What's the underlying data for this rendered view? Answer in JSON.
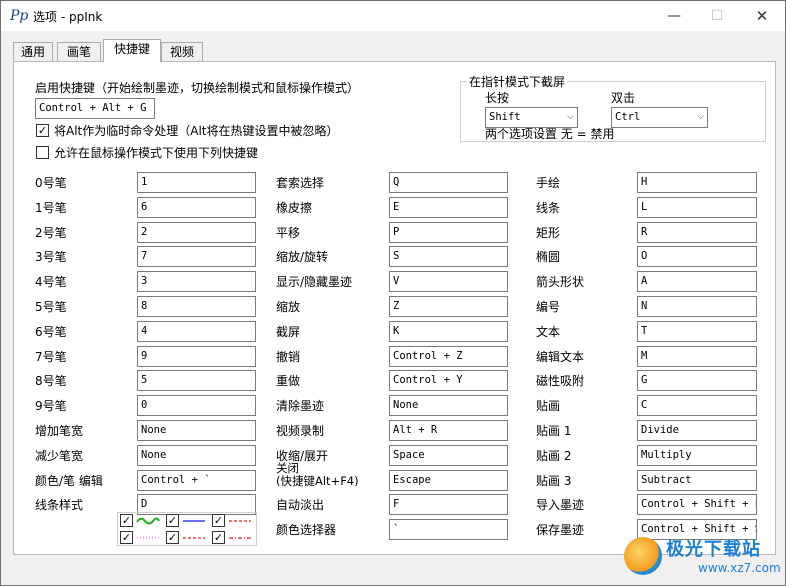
{
  "window": {
    "title": "选项 - ppInk",
    "icon": "ppink-app-icon"
  },
  "tabs": [
    {
      "label": "通用",
      "active": false
    },
    {
      "label": "画笔",
      "active": false
    },
    {
      "label": "快捷键",
      "active": true
    },
    {
      "label": "视频",
      "active": false
    }
  ],
  "hotkey": {
    "enable_label": "启用快捷键（开始绘制墨迹，切换绘制模式和鼠标操作模式）",
    "enable_value": "Control + Alt + G",
    "alt_temp_label": "将Alt作为临时命令处理（Alt将在热键设置中被忽略）",
    "alt_temp_checked": true,
    "mouse_mode_label": "允许在鼠标操作模式下使用下列快捷键",
    "mouse_mode_checked": false
  },
  "snapshot_group": {
    "title": "在指针模式下截屏",
    "long_press_label": "长按",
    "long_press_value": "Shift",
    "double_click_label": "双击",
    "double_click_value": "Ctrl",
    "note": "两个选项设置 无 = 禁用"
  },
  "col1": [
    {
      "label": "0号笔",
      "value": "1"
    },
    {
      "label": "1号笔",
      "value": "6"
    },
    {
      "label": "2号笔",
      "value": "2"
    },
    {
      "label": "3号笔",
      "value": "7"
    },
    {
      "label": "4号笔",
      "value": "3"
    },
    {
      "label": "5号笔",
      "value": "8"
    },
    {
      "label": "6号笔",
      "value": "4"
    },
    {
      "label": "7号笔",
      "value": "9"
    },
    {
      "label": "8号笔",
      "value": "5"
    },
    {
      "label": "9号笔",
      "value": "0"
    },
    {
      "label": "增加笔宽",
      "value": "None"
    },
    {
      "label": "减少笔宽",
      "value": "None"
    },
    {
      "label": "颜色/笔 编辑",
      "value": "Control + `"
    },
    {
      "label": "线条样式",
      "value": "D"
    }
  ],
  "col2": [
    {
      "label": "套索选择",
      "value": "Q"
    },
    {
      "label": "橡皮擦",
      "value": "E"
    },
    {
      "label": "平移",
      "value": "P"
    },
    {
      "label": "缩放/旋转",
      "value": "S"
    },
    {
      "label": "显示/隐藏墨迹",
      "value": "V"
    },
    {
      "label": "缩放",
      "value": "Z"
    },
    {
      "label": "截屏",
      "value": "K"
    },
    {
      "label": "撤销",
      "value": "Control + Z"
    },
    {
      "label": "重做",
      "value": "Control + Y"
    },
    {
      "label": "清除墨迹",
      "value": "None"
    },
    {
      "label": "视频录制",
      "value": "Alt + R"
    },
    {
      "label": "收缩/展开",
      "value": "Space"
    },
    {
      "label": "关闭\n(快捷键Alt+F4)",
      "value": "Escape"
    },
    {
      "label": "自动淡出",
      "value": "F"
    },
    {
      "label": "颜色选择器",
      "value": "`"
    }
  ],
  "col3": [
    {
      "label": "手绘",
      "value": "H"
    },
    {
      "label": "线条",
      "value": "L"
    },
    {
      "label": "矩形",
      "value": "R"
    },
    {
      "label": "椭圆",
      "value": "O"
    },
    {
      "label": "箭头形状",
      "value": "A"
    },
    {
      "label": "编号",
      "value": "N"
    },
    {
      "label": "文本",
      "value": "T"
    },
    {
      "label": "编辑文本",
      "value": "M"
    },
    {
      "label": "磁性吸附",
      "value": "G"
    },
    {
      "label": "贴画",
      "value": "C"
    },
    {
      "label": "贴画 1",
      "value": "Divide"
    },
    {
      "label": "贴画 2",
      "value": "Multiply"
    },
    {
      "label": "贴画 3",
      "value": "Subtract"
    },
    {
      "label": "导入墨迹",
      "value": "Control + Shift + L"
    },
    {
      "label": "保存墨迹",
      "value": "Control + Shift + S"
    }
  ],
  "line_styles": [
    {
      "checked": true,
      "style": "wavy",
      "color": "#22aa22"
    },
    {
      "checked": true,
      "style": "solid",
      "color": "#1a1aff"
    },
    {
      "checked": true,
      "style": "dashed",
      "color": "#e02020"
    },
    {
      "checked": true,
      "style": "dotted",
      "color": "#e060e0"
    },
    {
      "checked": true,
      "style": "dashed",
      "color": "#e02020"
    },
    {
      "checked": true,
      "style": "dashdot",
      "color": "#e02020"
    }
  ],
  "watermark": {
    "brand": "极光下载站",
    "url": "www.xz7.com"
  }
}
